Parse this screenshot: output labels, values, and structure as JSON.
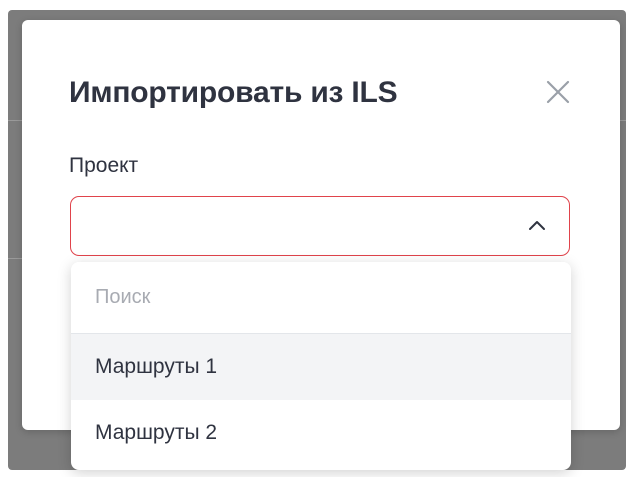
{
  "dialog": {
    "title": "Импортировать из ILS",
    "close_icon": "close-icon"
  },
  "form": {
    "project": {
      "label": "Проект",
      "value": "",
      "state": "open",
      "border_color": "#e0434b",
      "toggle_icon": "chevron-up-icon"
    }
  },
  "dropdown": {
    "search_placeholder": "Поиск",
    "options": [
      {
        "label": "Маршруты 1",
        "highlighted": true
      },
      {
        "label": "Маршруты 2",
        "highlighted": false
      }
    ]
  },
  "colors": {
    "overlay": "#7c7c7c",
    "text": "#2f3340",
    "error_border": "#e0434b",
    "placeholder": "#a8abb2",
    "highlight": "#f3f4f6",
    "accent": "#2e8bc9"
  }
}
